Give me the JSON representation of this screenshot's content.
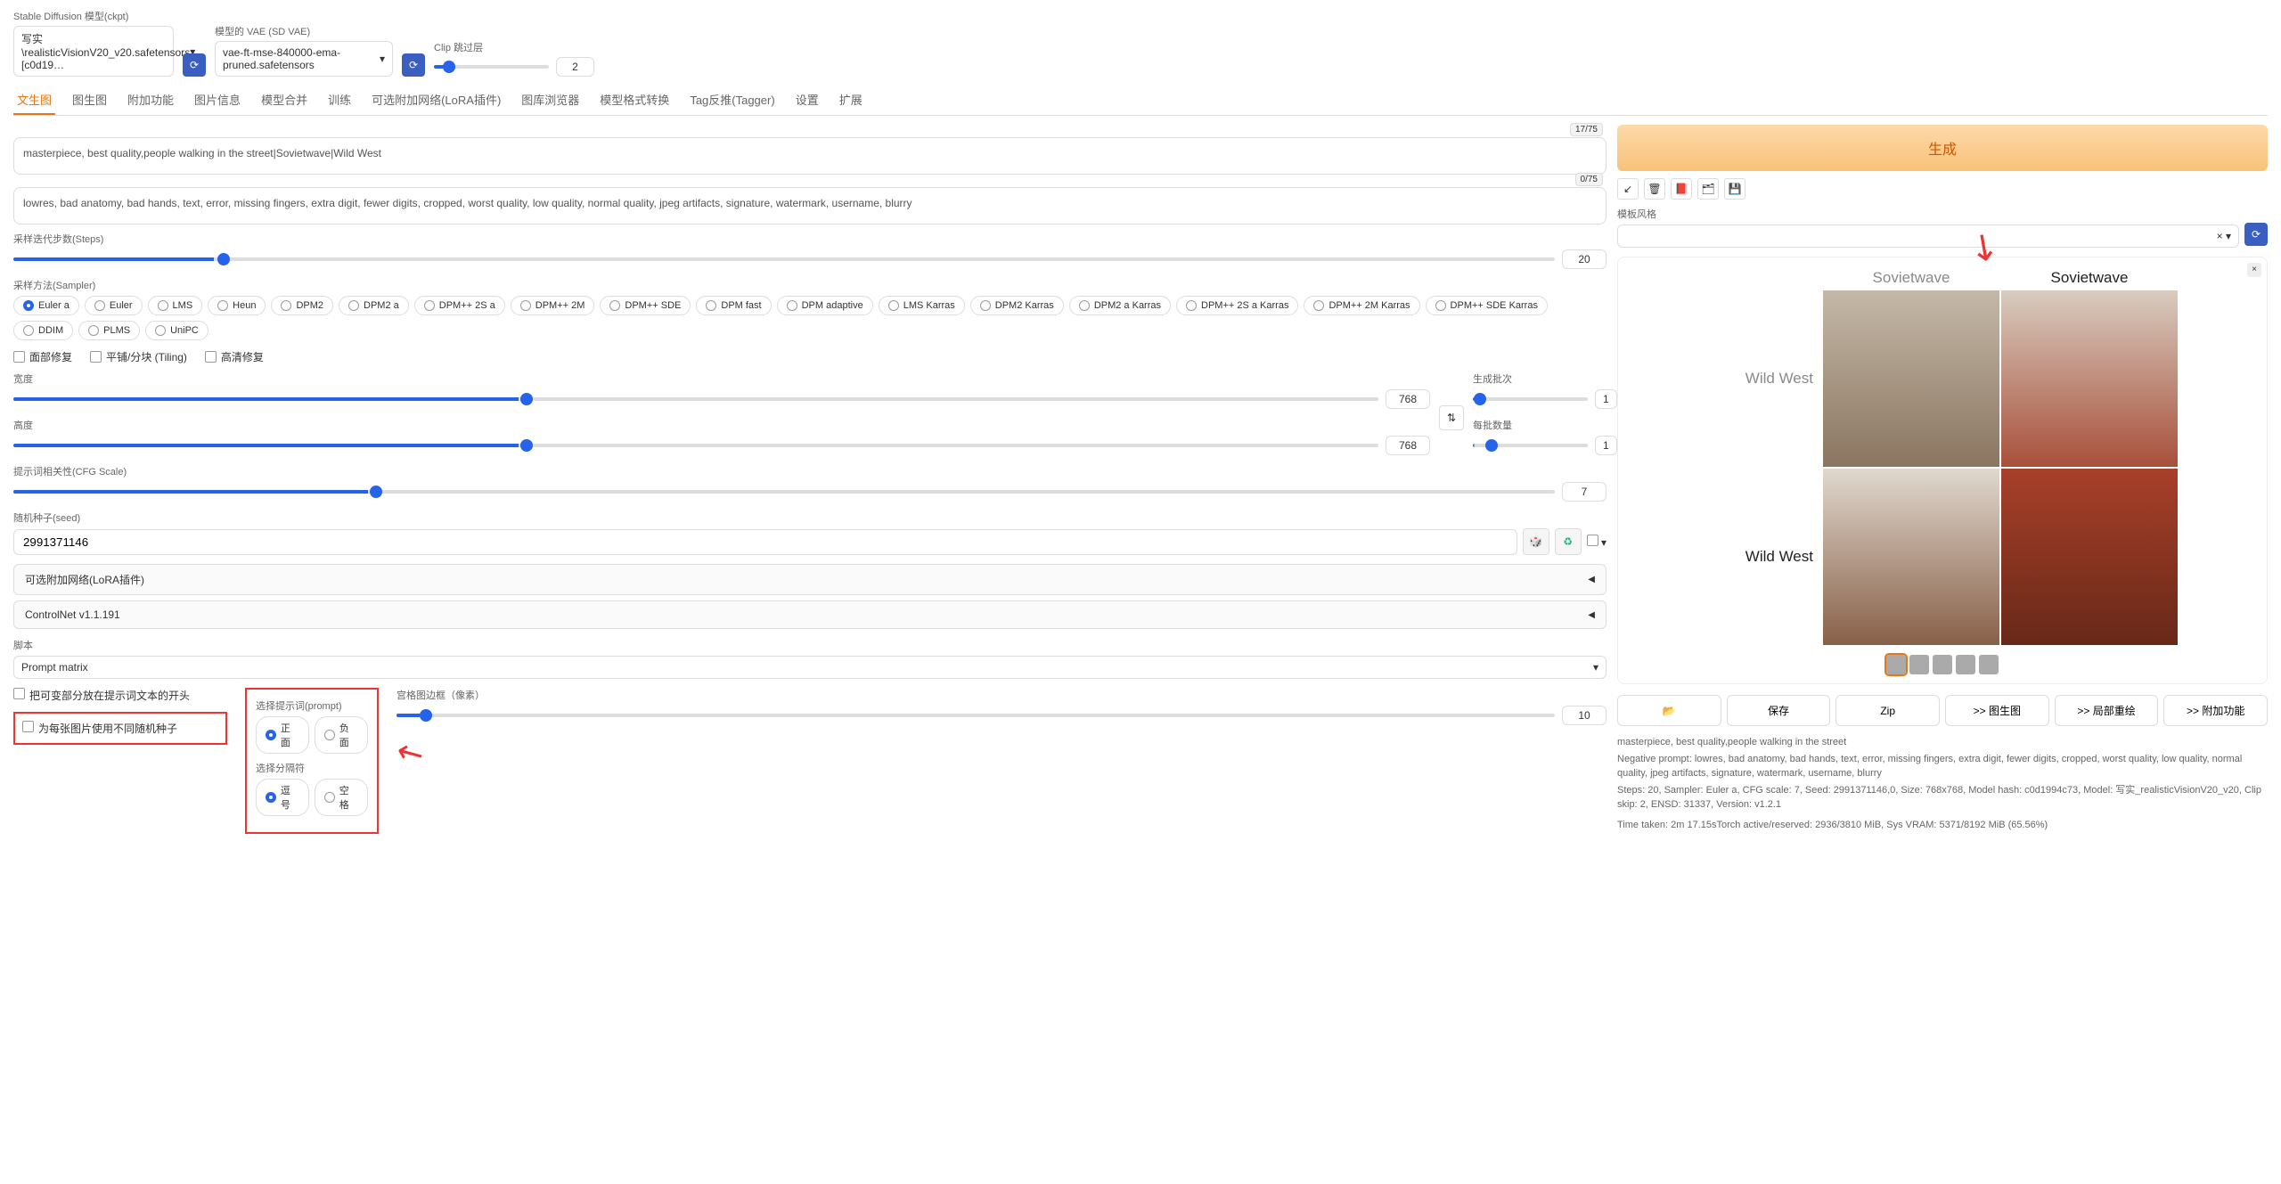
{
  "top": {
    "ckpt_label": "Stable Diffusion 模型(ckpt)",
    "ckpt_value": "写实\\realisticVisionV20_v20.safetensors [c0d19…",
    "vae_label": "模型的 VAE (SD VAE)",
    "vae_value": "vae-ft-mse-840000-ema-pruned.safetensors",
    "clip_label": "Clip 跳过层",
    "clip_value": "2"
  },
  "tabs": [
    "文生图",
    "图生图",
    "附加功能",
    "图片信息",
    "模型合并",
    "训练",
    "可选附加网络(LoRA插件)",
    "图库浏览器",
    "模型格式转换",
    "Tag反推(Tagger)",
    "设置",
    "扩展"
  ],
  "prompt": {
    "positive": "masterpiece, best quality,people walking in the street|Sovietwave|Wild West",
    "pos_count": "17/75",
    "negative": "lowres, bad anatomy, bad hands, text, error, missing fingers, extra digit, fewer digits, cropped, worst quality, low quality, normal quality, jpeg artifacts, signature, watermark, username, blurry",
    "neg_count": "0/75"
  },
  "steps": {
    "label": "采样迭代步数(Steps)",
    "value": "20"
  },
  "sampler": {
    "label": "采样方法(Sampler)",
    "options": [
      "Euler a",
      "Euler",
      "LMS",
      "Heun",
      "DPM2",
      "DPM2 a",
      "DPM++ 2S a",
      "DPM++ 2M",
      "DPM++ SDE",
      "DPM fast",
      "DPM adaptive",
      "LMS Karras",
      "DPM2 Karras",
      "DPM2 a Karras",
      "DPM++ 2S a Karras",
      "DPM++ 2M Karras",
      "DPM++ SDE Karras",
      "DDIM",
      "PLMS",
      "UniPC"
    ],
    "selected": "Euler a"
  },
  "checks": {
    "face": "面部修复",
    "tile": "平铺/分块 (Tiling)",
    "hires": "高清修复"
  },
  "size": {
    "width_label": "宽度",
    "width": "768",
    "height_label": "高度",
    "height": "768",
    "batch_count_label": "生成批次",
    "batch_count": "1",
    "batch_size_label": "每批数量",
    "batch_size": "1"
  },
  "cfg": {
    "label": "提示词相关性(CFG Scale)",
    "value": "7"
  },
  "seed": {
    "label": "随机种子(seed)",
    "value": "2991371146"
  },
  "accordions": {
    "lora": "可选附加网络(LoRA插件)",
    "controlnet": "ControlNet v1.1.191"
  },
  "script": {
    "label": "脚本",
    "value": "Prompt matrix",
    "opt1": "把可变部分放在提示词文本的开头",
    "opt2": "为每张图片使用不同随机种子",
    "prompt_select_label": "选择提示词(prompt)",
    "prompt_positive": "正面",
    "prompt_negative": "负面",
    "sep_label": "选择分隔符",
    "sep_comma": "逗号",
    "sep_space": "空格",
    "margin_label": "宫格图边框（像素）",
    "margin_value": "10"
  },
  "right": {
    "generate": "生成",
    "style_label": "模板风格",
    "grid": {
      "cols": [
        "Sovietwave",
        "Sovietwave"
      ],
      "rows": [
        "Wild West",
        "Wild West"
      ]
    },
    "actions": {
      "folder": "📂",
      "save": "保存",
      "zip": "Zip",
      "img2img": ">> 图生图",
      "inpaint": ">> 局部重绘",
      "extras": ">> 附加功能"
    },
    "meta": {
      "prompt_line": "masterpiece, best quality,people walking in the street",
      "neg_line": "Negative prompt: lowres, bad anatomy, bad hands, text, error, missing fingers, extra digit, fewer digits, cropped, worst quality, low quality, normal quality, jpeg artifacts, signature, watermark, username, blurry",
      "params_line": "Steps: 20, Sampler: Euler a, CFG scale: 7, Seed: 2991371146,0, Size: 768x768, Model hash: c0d1994c73, Model: 写实_realisticVisionV20_v20, Clip skip: 2, ENSD: 31337, Version: v1.2.1",
      "time_line": "Time taken: 2m 17.15sTorch active/reserved: 2936/3810 MiB, Sys VRAM: 5371/8192 MiB (65.56%)"
    }
  },
  "chart_data": {
    "type": "table",
    "title": "Prompt matrix output grid",
    "columns": [
      "Sovietwave",
      "Sovietwave"
    ],
    "rows": [
      "Wild West",
      "Wild West"
    ],
    "cells": [
      [
        "image",
        "image"
      ],
      [
        "image",
        "image"
      ]
    ]
  }
}
